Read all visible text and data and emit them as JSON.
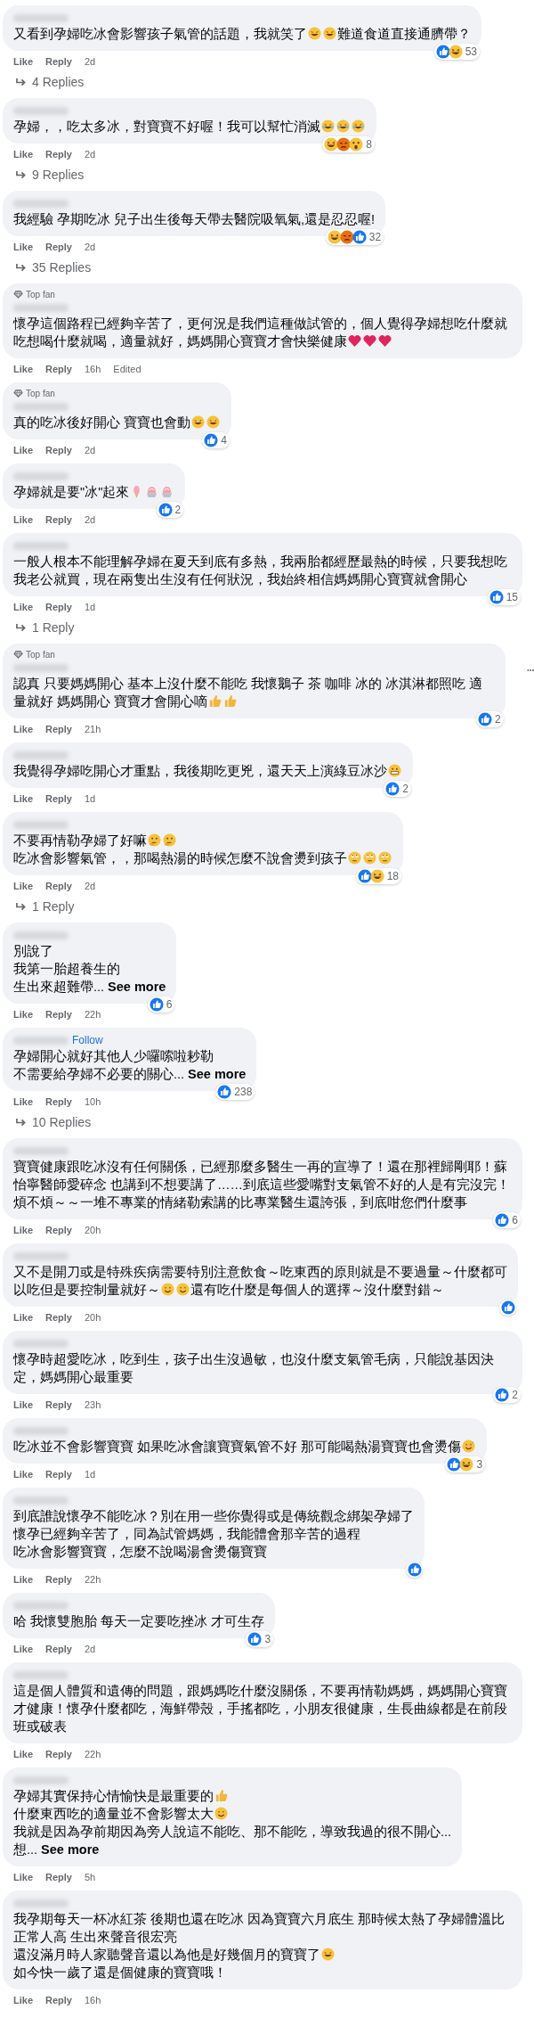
{
  "comments": [
    {
      "lines": [
        [
          {
            "kind": "text",
            "text": "又看到孕婦吃冰會影響孩子氣管的話題，我就笑了"
          },
          {
            "kind": "rofl"
          },
          {
            "kind": "rofl"
          },
          {
            "kind": "text",
            "text": "難道食道直接通臍帶？"
          }
        ]
      ],
      "reactions": [
        {
          "kind": "like"
        },
        {
          "kind": "haha"
        }
      ],
      "reaction_count": "53",
      "like": "Like",
      "reply": "Reply",
      "time": "2d",
      "replies": "4 Replies"
    },
    {
      "lines": [
        [
          {
            "kind": "text",
            "text": "孕婦，，吃太多冰，對寶寶不好喔！我可以幫忙消滅"
          },
          {
            "kind": "joy"
          },
          {
            "kind": "joy"
          },
          {
            "kind": "joy"
          }
        ]
      ],
      "reactions": [
        {
          "kind": "haha"
        },
        {
          "kind": "angry"
        },
        {
          "kind": "wow"
        }
      ],
      "reaction_count": "8",
      "like": "Like",
      "reply": "Reply",
      "time": "2d",
      "replies": "9 Replies"
    },
    {
      "lines": [
        [
          {
            "kind": "text",
            "text": "我經驗 孕期吃冰 兒子出生後每天帶去醫院吸氧氣,還是忍忍喔!"
          }
        ]
      ],
      "reactions": [
        {
          "kind": "haha"
        },
        {
          "kind": "angry"
        },
        {
          "kind": "like"
        }
      ],
      "reaction_count": "32",
      "like": "Like",
      "reply": "Reply",
      "time": "2d",
      "replies": "35 Replies"
    },
    {
      "top_fan_label": "Top fan",
      "lines": [
        [
          {
            "kind": "text",
            "text": "懷孕這個路程已經夠辛苦了，更何況是我們這種做試管的，個人覺得孕婦想吃什麼就吃想喝什麼就喝，適量就好，媽媽開心寶寶才會快樂健康"
          },
          {
            "kind": "heart"
          },
          {
            "kind": "heart"
          },
          {
            "kind": "heart"
          }
        ]
      ],
      "like": "Like",
      "reply": "Reply",
      "time": "16h",
      "edited": "Edited"
    },
    {
      "top_fan_label": "Top fan",
      "lines": [
        [
          {
            "kind": "text",
            "text": "真的吃冰後好開心 寶寶也會動"
          },
          {
            "kind": "rofl"
          },
          {
            "kind": "rofl"
          }
        ]
      ],
      "reactions": [
        {
          "kind": "like"
        }
      ],
      "reaction_count": "4",
      "like": "Like",
      "reply": "Reply",
      "time": "2d"
    },
    {
      "lines": [
        [
          {
            "kind": "text",
            "text": "孕婦就是要\"冰\"起來"
          },
          {
            "kind": "icecream"
          },
          {
            "kind": "shavedice"
          },
          {
            "kind": "shavedice"
          }
        ]
      ],
      "reactions": [
        {
          "kind": "like"
        }
      ],
      "reaction_count": "2",
      "like": "Like",
      "reply": "Reply",
      "time": "2d"
    },
    {
      "lines": [
        [
          {
            "kind": "text",
            "text": "一般人根本不能理解孕婦在夏天到底有多熱，我兩胎都經歷最熱的時候，只要我想吃我老公就買，現在兩隻出生沒有任何狀況，我始終相信媽媽開心寶寶就會開心"
          }
        ]
      ],
      "reactions": [
        {
          "kind": "like"
        }
      ],
      "reaction_count": "15",
      "like": "Like",
      "reply": "Reply",
      "time": "1d",
      "replies": "1 Reply"
    },
    {
      "top_fan_label": "Top fan",
      "more": true,
      "lines": [
        [
          {
            "kind": "text",
            "text": "認真 只要媽媽開心 基本上沒什麼不能吃 我懷鵝子 茶 咖啡 冰的 冰淇淋都照吃 適量就好 媽媽開心 寶寶才會開心嘀"
          },
          {
            "kind": "thumbsup"
          },
          {
            "kind": "thumbsup"
          }
        ]
      ],
      "reactions": [
        {
          "kind": "like"
        }
      ],
      "reaction_count": "2",
      "like": "Like",
      "reply": "Reply",
      "time": "21h"
    },
    {
      "lines": [
        [
          {
            "kind": "text",
            "text": "我覺得孕婦吃開心才重點，我後期吃更兇，還天天上演綠豆冰沙"
          },
          {
            "kind": "grimace"
          }
        ]
      ],
      "reactions": [
        {
          "kind": "like"
        }
      ],
      "reaction_count": "2",
      "like": "Like",
      "reply": "Reply",
      "time": "1d"
    },
    {
      "lines": [
        [
          {
            "kind": "text",
            "text": "不要再情勒孕婦了好嘛"
          },
          {
            "kind": "thinking"
          },
          {
            "kind": "thinking"
          }
        ],
        [
          {
            "kind": "text",
            "text": "吃冰會影響氣管，，那喝熱湯的時候怎麼不說會燙到孩子"
          },
          {
            "kind": "rolleyes"
          },
          {
            "kind": "rolleyes"
          },
          {
            "kind": "rolleyes"
          }
        ]
      ],
      "reactions": [
        {
          "kind": "like"
        },
        {
          "kind": "haha"
        }
      ],
      "reaction_count": "18",
      "like": "Like",
      "reply": "Reply",
      "time": "2d",
      "replies": "1 Reply"
    },
    {
      "lines": [
        [
          {
            "kind": "text",
            "text": "別說了"
          }
        ],
        [
          {
            "kind": "text",
            "text": "我第一胎超養生的"
          }
        ],
        [
          {
            "kind": "text",
            "text": "生出來超難帶..."
          }
        ]
      ],
      "see_more_label": "See more",
      "reactions": [
        {
          "kind": "like"
        }
      ],
      "reaction_count": "6",
      "like": "Like",
      "reply": "Reply",
      "time": "22h"
    },
    {
      "follow_label": "Follow",
      "lines": [
        [
          {
            "kind": "text",
            "text": "孕婦開心就好其他人少囉嗦啦耖勒"
          }
        ],
        [
          {
            "kind": "text",
            "text": "不需要給孕婦不必要的關心..."
          }
        ]
      ],
      "see_more_label": "See more",
      "reactions": [
        {
          "kind": "like"
        }
      ],
      "reaction_count": "238",
      "like": "Like",
      "reply": "Reply",
      "time": "10h",
      "replies": "10 Replies"
    },
    {
      "lines": [
        [
          {
            "kind": "text",
            "text": "寶寶健康跟吃冰沒有任何關係，已經那麼多醫生一再的宣導了！還在那裡歸剛耶！蘇怡寧醫師愛碎念 也講到不想要講了……到底這些愛嘴對支氣管不好的人是有完沒完！煩不煩～～一堆不專業的情緒勒索講的比專業醫生還誇張，到底咁您們什麼事"
          }
        ]
      ],
      "reactions": [
        {
          "kind": "like"
        }
      ],
      "reaction_count": "6",
      "like": "Like",
      "reply": "Reply",
      "time": "20h"
    },
    {
      "lines": [
        [
          {
            "kind": "text",
            "text": "又不是開刀或是特殊疾病需要特別注意飲食～吃東西的原則就是不要過量～什麼都可"
          }
        ],
        [
          {
            "kind": "text",
            "text": "以吃但是要控制量就好～"
          },
          {
            "kind": "smile"
          },
          {
            "kind": "smile"
          },
          {
            "kind": "text",
            "text": "還有吃什麼是每個人的選擇～沒什麼對錯～"
          }
        ]
      ],
      "reactions": [
        {
          "kind": "like"
        }
      ],
      "like": "Like",
      "reply": "Reply",
      "time": "20h"
    },
    {
      "lines": [
        [
          {
            "kind": "text",
            "text": "懷孕時超愛吃冰，吃到生，孩子出生沒過敏，也沒什麼支氣管毛病，只能說基因決定，媽媽開心最重要"
          }
        ]
      ],
      "reactions": [
        {
          "kind": "like"
        }
      ],
      "reaction_count": "2",
      "like": "Like",
      "reply": "Reply",
      "time": "23h"
    },
    {
      "lines": [
        [
          {
            "kind": "text",
            "text": "吃冰並不會影響寶寶 如果吃冰會讓寶寶氣管不好 那可能喝熱湯寶寶也會燙傷"
          },
          {
            "kind": "sweat"
          }
        ]
      ],
      "reactions": [
        {
          "kind": "like"
        },
        {
          "kind": "haha"
        }
      ],
      "reaction_count": "3",
      "like": "Like",
      "reply": "Reply",
      "time": "1d"
    },
    {
      "lines": [
        [
          {
            "kind": "text",
            "text": "到底誰說懷孕不能吃冰？別在用一些你覺得或是傳統觀念綁架孕婦了"
          }
        ],
        [
          {
            "kind": "text",
            "text": "懷孕已經夠辛苦了，同為試管媽媽，我能體會那辛苦的過程"
          }
        ],
        [
          {
            "kind": "text",
            "text": "吃冰會影響寶寶，怎麼不說喝湯會燙傷寶寶"
          }
        ]
      ],
      "reactions": [
        {
          "kind": "like"
        }
      ],
      "like": "Like",
      "reply": "Reply",
      "time": "22h"
    },
    {
      "lines": [
        [
          {
            "kind": "text",
            "text": "哈 我懷雙胞胎 每天一定要吃挫冰 才可生存"
          }
        ]
      ],
      "reactions": [
        {
          "kind": "like"
        }
      ],
      "reaction_count": "3",
      "like": "Like",
      "reply": "Reply",
      "time": "2d"
    },
    {
      "lines": [
        [
          {
            "kind": "text",
            "text": "這是個人體質和遺傳的問題，跟媽媽吃什麼沒關係，不要再情勒媽媽，媽媽開心寶寶才健康！懷孕什麼都吃，海鮮帶殼，手搖都吃，小朋友很健康，生長曲線都是在前段班或破表"
          }
        ]
      ],
      "like": "Like",
      "reply": "Reply",
      "time": "22h"
    },
    {
      "lines": [
        [
          {
            "kind": "text",
            "text": "孕婦其實保持心情愉快是最重要的"
          },
          {
            "kind": "thumbsup"
          }
        ],
        [
          {
            "kind": "text",
            "text": "什麼東西吃的適量並不會影響太大"
          },
          {
            "kind": "smile"
          }
        ],
        [
          {
            "kind": "text",
            "text": "我就是因為孕前期因為旁人說這不能吃、那不能吃，導致我過的很不開心..."
          }
        ],
        [
          {
            "kind": "text",
            "text": "想..."
          }
        ]
      ],
      "see_more_label": "See more",
      "like": "Like",
      "reply": "Reply",
      "time": "5h"
    },
    {
      "lines": [
        [
          {
            "kind": "text",
            "text": "我孕期每天一杯冰紅茶 後期也還在吃冰 因為寶寶六月底生 那時候太熱了孕婦體溫比正常人高 生出來聲音很宏亮"
          }
        ],
        [
          {
            "kind": "text",
            "text": "還沒滿月時人家聽聲音還以為他是好幾個月的寶寶了"
          },
          {
            "kind": "rofl"
          }
        ],
        [
          {
            "kind": "text",
            "text": "如今快一歲了還是個健康的寶寶哦！"
          }
        ]
      ],
      "like": "Like",
      "reply": "Reply",
      "time": "16h"
    }
  ]
}
